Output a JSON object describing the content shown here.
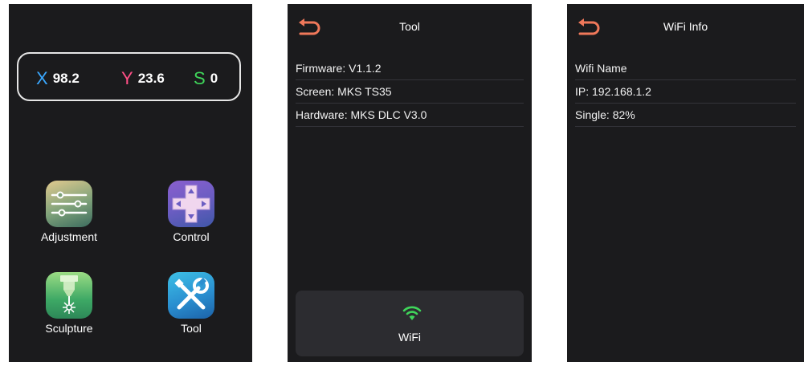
{
  "home": {
    "coords": {
      "x": {
        "letter": "X",
        "value": "98.2"
      },
      "y": {
        "letter": "Y",
        "value": "23.6"
      },
      "s": {
        "letter": "S",
        "value": "0"
      }
    },
    "apps": [
      {
        "label": "Adjustment",
        "icon": "sliders-icon"
      },
      {
        "label": "Control",
        "icon": "dpad-icon"
      },
      {
        "label": "Sculpture",
        "icon": "laser-engraver-icon"
      },
      {
        "label": "Tool",
        "icon": "wrench-screwdriver-icon"
      }
    ]
  },
  "tool_screen": {
    "title": "Tool",
    "rows": [
      "Firmware: V1.1.2",
      "Screen: MKS TS35",
      "Hardware: MKS DLC V3.0"
    ],
    "wifi_button": {
      "label": "WiFi",
      "icon": "wifi-icon"
    }
  },
  "wifi_screen": {
    "title": "WiFi Info",
    "rows": [
      "Wifi Name",
      "IP: 192.168.1.2",
      "Single: 82%"
    ]
  },
  "colors": {
    "screen_bg": "#1b1b1d",
    "back_arrow": "#f0785a",
    "x_axis": "#3aa8ff",
    "y_axis": "#ff4f86",
    "s_axis": "#3fd65a",
    "wifi": "#3fd65a"
  }
}
